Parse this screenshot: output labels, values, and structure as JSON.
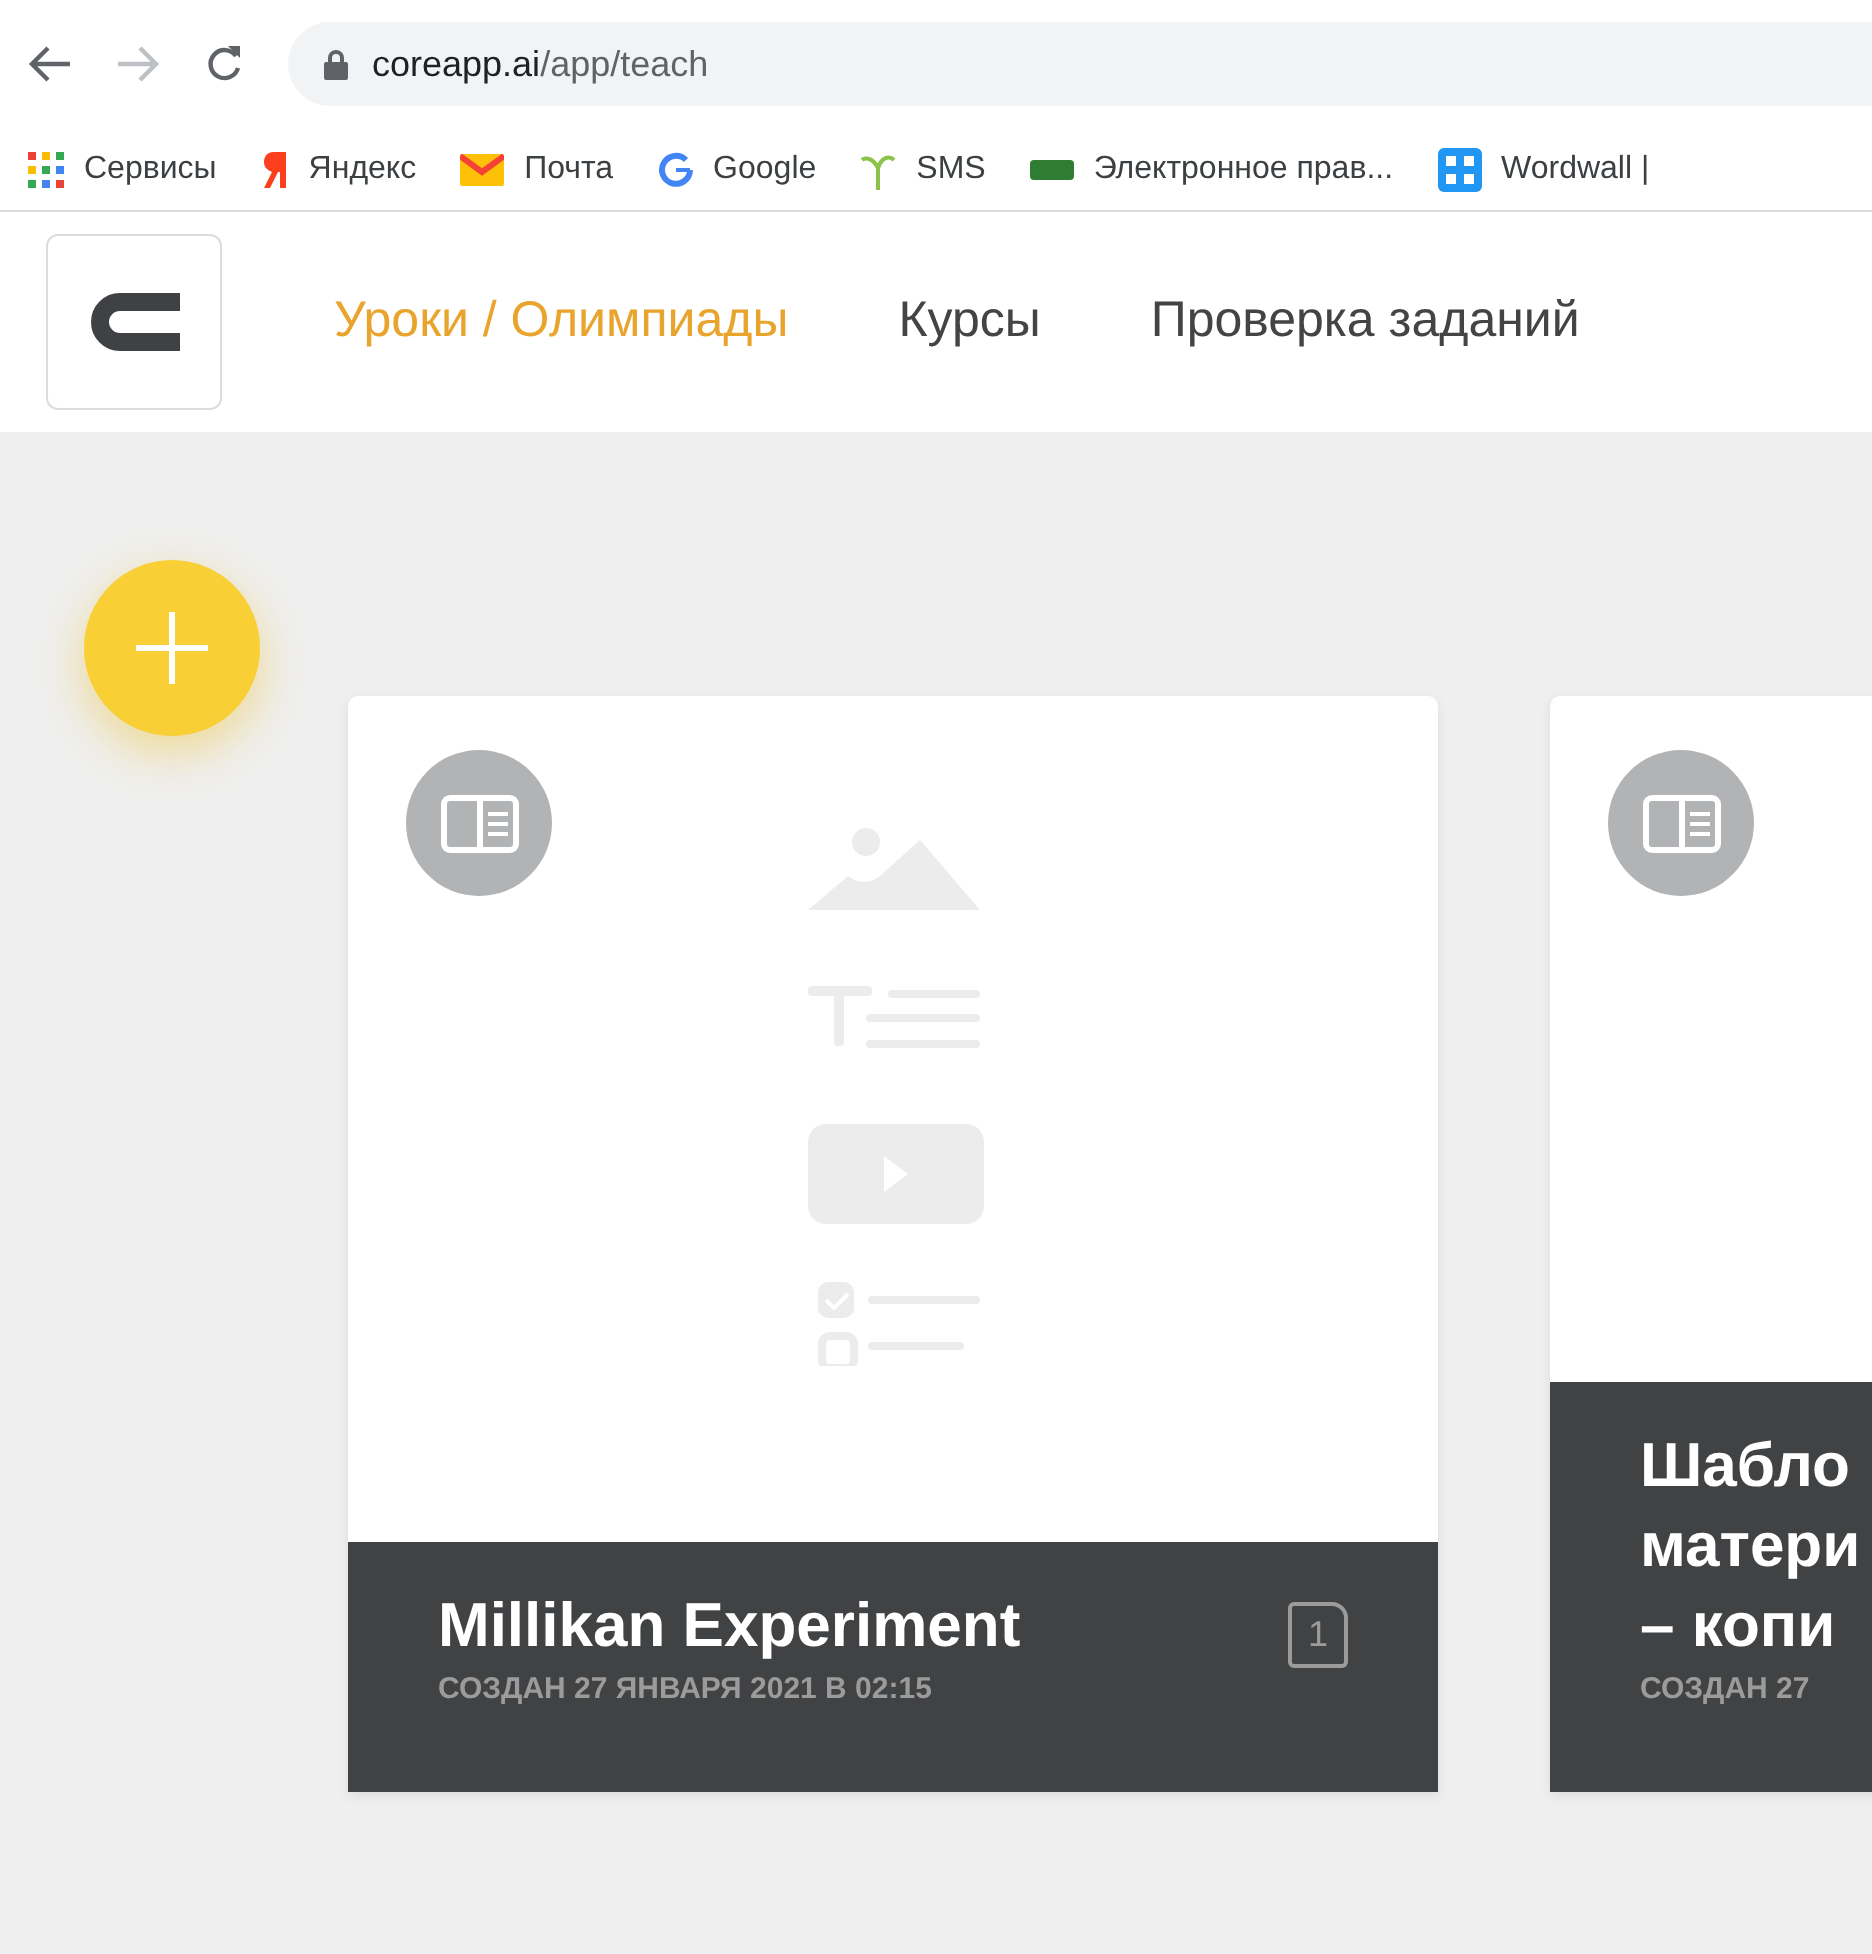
{
  "browser": {
    "url_host": "coreapp.ai",
    "url_path": "/app/teach",
    "bookmarks": [
      {
        "kind": "apps",
        "label": "Сервисы"
      },
      {
        "kind": "yandex",
        "label": "Яндекс"
      },
      {
        "kind": "mail",
        "label": "Почта"
      },
      {
        "kind": "google",
        "label": "Google"
      },
      {
        "kind": "sms",
        "label": "SMS"
      },
      {
        "kind": "egov",
        "label": "Электронное прав..."
      },
      {
        "kind": "wordwall",
        "label": "Wordwall |"
      }
    ]
  },
  "nav": [
    {
      "label": "Уроки / Олимпиады",
      "selected": true
    },
    {
      "label": "Курсы",
      "selected": false
    },
    {
      "label": "Проверка заданий",
      "selected": false
    }
  ],
  "cards": [
    {
      "title_lines": [
        "Millikan Experiment"
      ],
      "date": "СОЗДАН 27 ЯНВАРЯ 2021 В 02:15",
      "page_count": "1",
      "placeholder": true
    },
    {
      "title_lines": [
        "Шабло",
        "матери",
        "– копи"
      ],
      "date": "СОЗДАН 27"
    }
  ]
}
